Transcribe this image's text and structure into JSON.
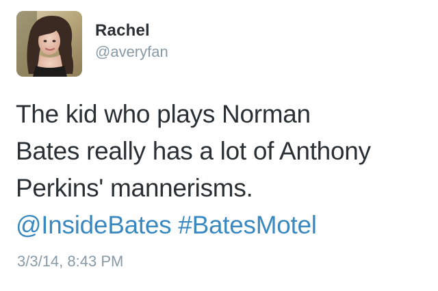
{
  "author": {
    "display_name": "Rachel",
    "handle": "@averyfan"
  },
  "tweet": {
    "lines": [
      "The kid who plays Norman",
      "Bates really has a lot of Anthony",
      "Perkins' mannerisms."
    ],
    "mention": "@InsideBates",
    "hashtag": "#BatesMotel",
    "timestamp": "3/3/14, 8:43 PM"
  },
  "colors": {
    "text": "#292f33",
    "secondary": "#8899a6",
    "link": "#3a88c0"
  }
}
